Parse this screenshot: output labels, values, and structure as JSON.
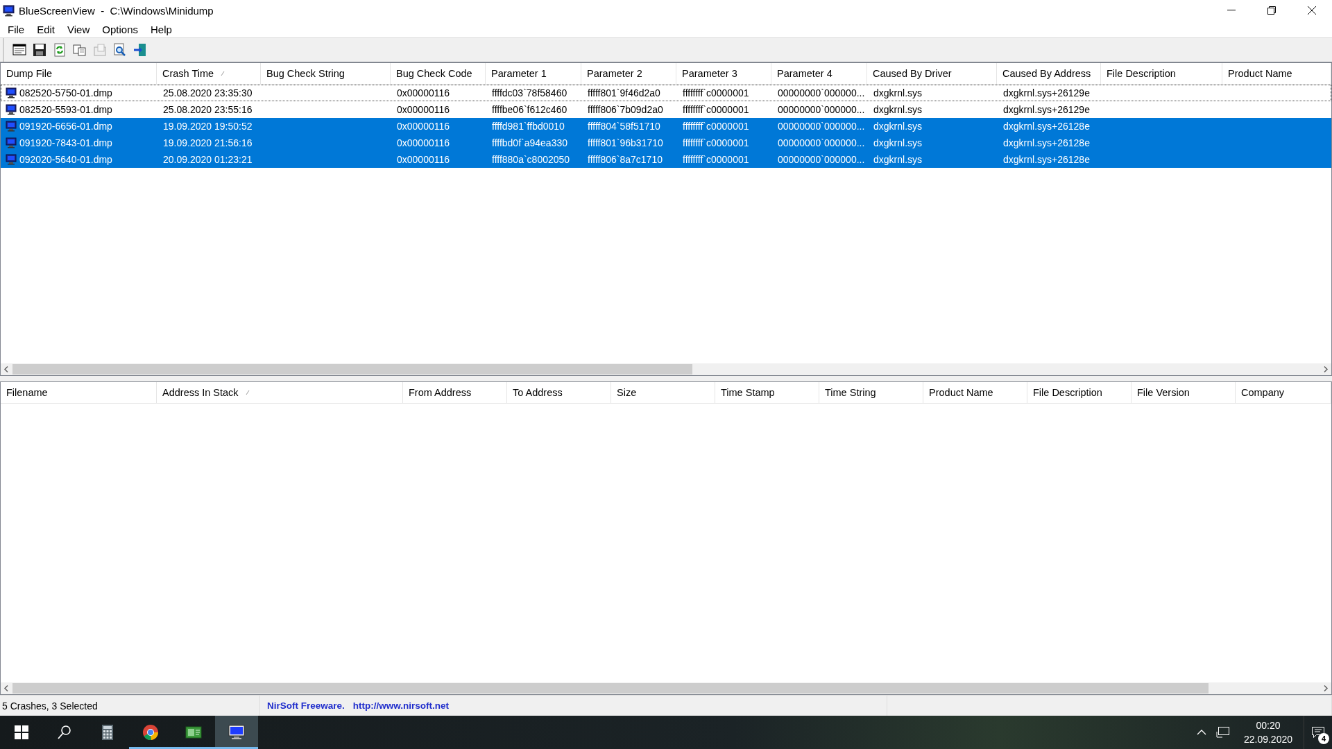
{
  "window": {
    "title": "BlueScreenView  -  C:\\Windows\\Minidump"
  },
  "menu": [
    "File",
    "Edit",
    "View",
    "Options",
    "Help"
  ],
  "crash_list": {
    "columns": [
      {
        "label": "Dump File",
        "sorted": false
      },
      {
        "label": "Crash Time",
        "sorted": true
      },
      {
        "label": "Bug Check String",
        "sorted": false
      },
      {
        "label": "Bug Check Code",
        "sorted": false
      },
      {
        "label": "Parameter 1",
        "sorted": false
      },
      {
        "label": "Parameter 2",
        "sorted": false
      },
      {
        "label": "Parameter 3",
        "sorted": false
      },
      {
        "label": "Parameter 4",
        "sorted": false
      },
      {
        "label": "Caused By Driver",
        "sorted": false
      },
      {
        "label": "Caused By Address",
        "sorted": false
      },
      {
        "label": "File Description",
        "sorted": false
      },
      {
        "label": "Product Name",
        "sorted": false
      }
    ],
    "rows": [
      {
        "selected": false,
        "focused": true,
        "cells": [
          "082520-5750-01.dmp",
          "25.08.2020 23:35:30",
          null,
          "0x00000116",
          "ffffdc03`78f58460",
          "fffff801`9f46d2a0",
          "ffffffff`c0000001",
          "00000000`000000...",
          "dxgkrnl.sys",
          "dxgkrnl.sys+26129e",
          null,
          null
        ]
      },
      {
        "selected": false,
        "focused": false,
        "cells": [
          "082520-5593-01.dmp",
          "25.08.2020 23:55:16",
          null,
          "0x00000116",
          "ffffbe06`f612c460",
          "fffff806`7b09d2a0",
          "ffffffff`c0000001",
          "00000000`000000...",
          "dxgkrnl.sys",
          "dxgkrnl.sys+26129e",
          null,
          null
        ]
      },
      {
        "selected": true,
        "focused": false,
        "cells": [
          "091920-6656-01.dmp",
          "19.09.2020 19:50:52",
          null,
          "0x00000116",
          "ffffd981`ffbd0010",
          "fffff804`58f51710",
          "ffffffff`c0000001",
          "00000000`000000...",
          "dxgkrnl.sys",
          "dxgkrnl.sys+26128e",
          null,
          null
        ]
      },
      {
        "selected": true,
        "focused": false,
        "cells": [
          "091920-7843-01.dmp",
          "19.09.2020 21:56:16",
          null,
          "0x00000116",
          "ffffbd0f`a94ea330",
          "fffff801`96b31710",
          "ffffffff`c0000001",
          "00000000`000000...",
          "dxgkrnl.sys",
          "dxgkrnl.sys+26128e",
          null,
          null
        ]
      },
      {
        "selected": true,
        "focused": false,
        "cells": [
          "092020-5640-01.dmp",
          "20.09.2020 01:23:21",
          null,
          "0x00000116",
          "ffff880a`c8002050",
          "fffff806`8a7c1710",
          "ffffffff`c0000001",
          "00000000`000000...",
          "dxgkrnl.sys",
          "dxgkrnl.sys+26128e",
          null,
          null
        ]
      }
    ]
  },
  "module_list": {
    "columns": [
      {
        "label": "Filename",
        "sorted": false
      },
      {
        "label": "Address In Stack",
        "sorted": true
      },
      {
        "label": "From Address",
        "sorted": false
      },
      {
        "label": "To Address",
        "sorted": false
      },
      {
        "label": "Size",
        "sorted": false
      },
      {
        "label": "Time Stamp",
        "sorted": false
      },
      {
        "label": "Time String",
        "sorted": false
      },
      {
        "label": "Product Name",
        "sorted": false
      },
      {
        "label": "File Description",
        "sorted": false
      },
      {
        "label": "File Version",
        "sorted": false
      },
      {
        "label": "Company",
        "sorted": false
      }
    ]
  },
  "status_bar": {
    "count": "5 Crashes, 3 Selected",
    "credit": "NirSoft Freeware.",
    "link": "http://www.nirsoft.net"
  },
  "taskbar": {
    "apps": [
      {
        "kind": "start",
        "running": false,
        "active": false
      },
      {
        "kind": "search",
        "running": false,
        "active": false
      },
      {
        "kind": "calculator",
        "running": false,
        "active": false
      },
      {
        "kind": "browser",
        "running": true,
        "active": false
      },
      {
        "kind": "image-viewer",
        "running": true,
        "active": false
      },
      {
        "kind": "bluescreen",
        "running": true,
        "active": true
      }
    ],
    "clock": {
      "time": "00:20",
      "date": "22.09.2020"
    },
    "notifications": {
      "count": "4"
    }
  }
}
